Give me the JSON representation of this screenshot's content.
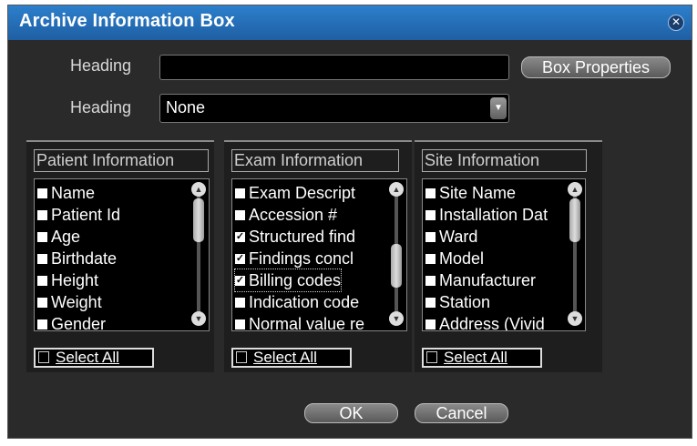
{
  "window": {
    "title": "Archive Information Box",
    "close_icon": "close-icon"
  },
  "form": {
    "heading1_label": "Heading",
    "heading1_value": "",
    "box_properties_label": "Box Properties",
    "heading2_label": "Heading",
    "heading2_value": "None"
  },
  "panels": [
    {
      "title": "Patient Information",
      "items": [
        {
          "label": "Name",
          "checked": false
        },
        {
          "label": "Patient Id",
          "checked": false
        },
        {
          "label": "Age",
          "checked": false
        },
        {
          "label": "Birthdate",
          "checked": false
        },
        {
          "label": "Height",
          "checked": false
        },
        {
          "label": "Weight",
          "checked": false
        },
        {
          "label": "Gender",
          "checked": false
        }
      ],
      "select_all": "Select All"
    },
    {
      "title": "Exam Information",
      "items": [
        {
          "label": "Exam Descript",
          "checked": false
        },
        {
          "label": "Accession #",
          "checked": false
        },
        {
          "label": "Structured find",
          "checked": true
        },
        {
          "label": "Findings concl",
          "checked": true
        },
        {
          "label": "Billing codes",
          "checked": true
        },
        {
          "label": "Indication code",
          "checked": false
        },
        {
          "label": "Normal value re",
          "checked": false
        }
      ],
      "select_all": "Select All"
    },
    {
      "title": "Site Information",
      "items": [
        {
          "label": "Site Name",
          "checked": false
        },
        {
          "label": "Installation Dat",
          "checked": false
        },
        {
          "label": "Ward",
          "checked": false
        },
        {
          "label": "Model",
          "checked": false
        },
        {
          "label": "Manufacturer",
          "checked": false
        },
        {
          "label": "Station",
          "checked": false
        },
        {
          "label": "Address (Vivid",
          "checked": false
        }
      ],
      "select_all": "Select All"
    }
  ],
  "buttons": {
    "ok": "OK",
    "cancel": "Cancel"
  }
}
